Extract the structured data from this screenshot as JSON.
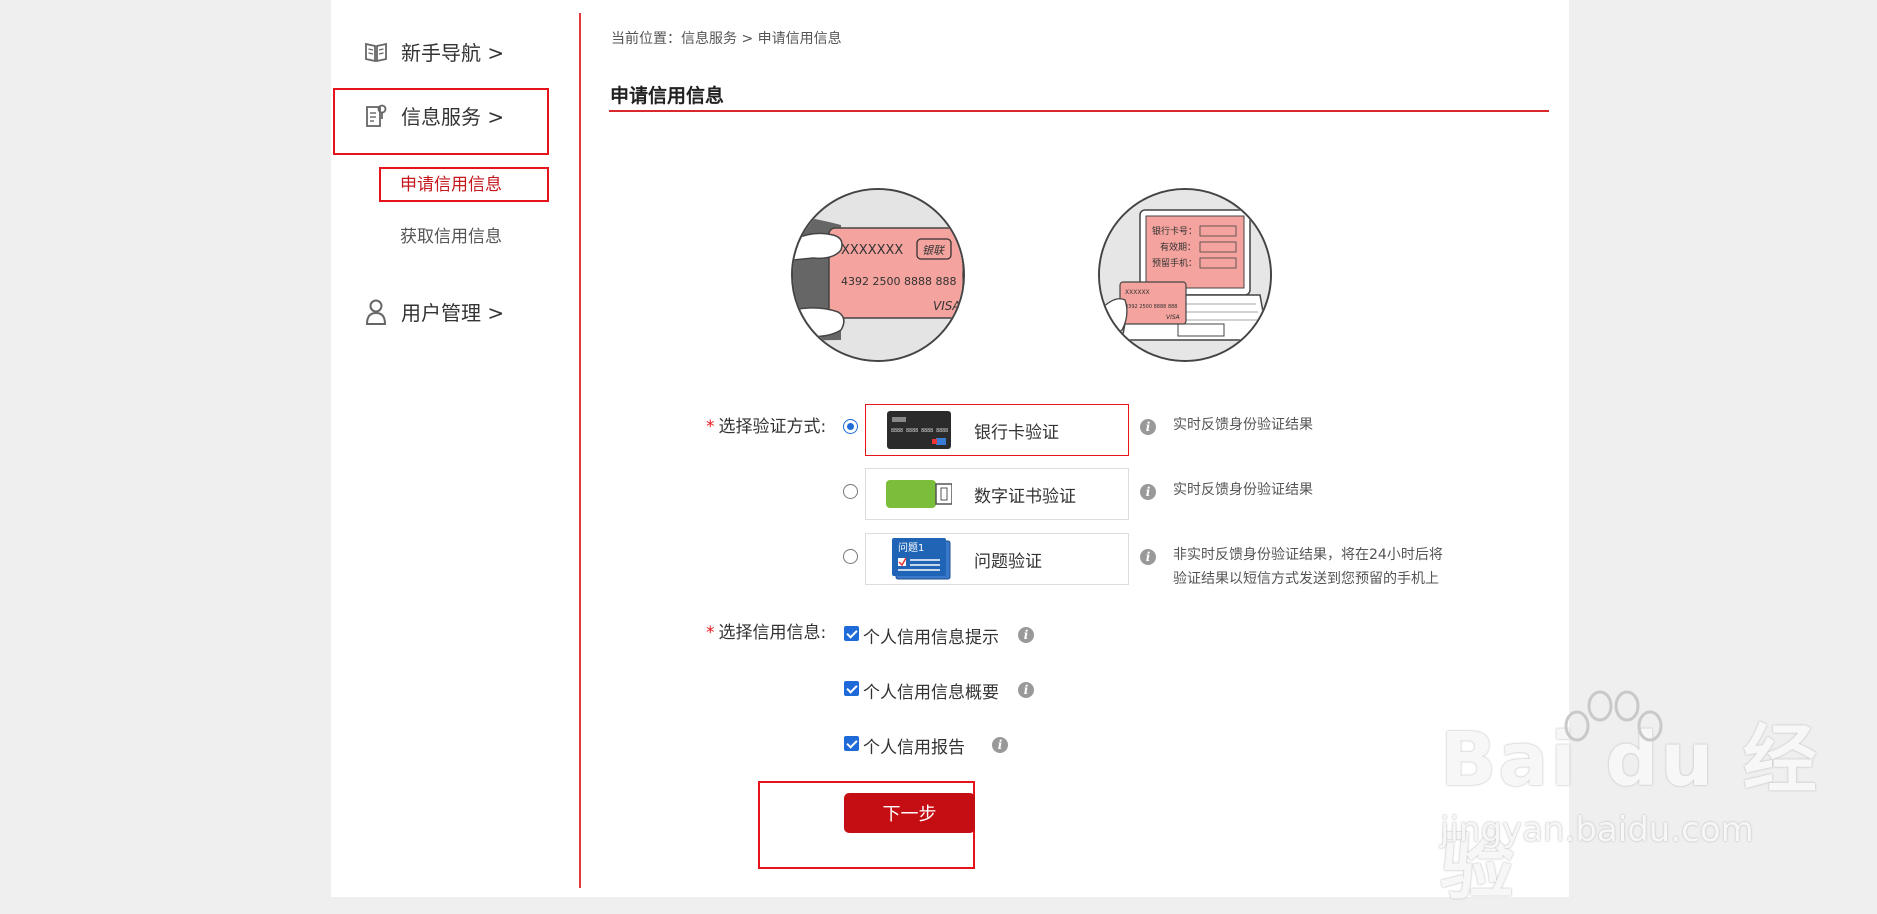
{
  "sidebar": {
    "items": [
      {
        "label": "新手导航 >",
        "icon": "book-icon"
      },
      {
        "label": "信息服务 >",
        "icon": "document-icon"
      },
      {
        "label": "用户管理 >",
        "icon": "user-icon"
      }
    ],
    "sub_items": [
      {
        "label": "申请信用信息",
        "active": true
      },
      {
        "label": "获取信用信息",
        "active": false
      }
    ]
  },
  "breadcrumb": "当前位置：信息服务 > 申请信用信息",
  "page_title": "申请信用信息",
  "illustrations": {
    "card": {
      "name": "XXXXXXX",
      "brand": "银联",
      "number": "4392 2500 8888 888",
      "scheme": "VISA"
    },
    "laptop": {
      "fields": [
        "银行卡号：",
        "有效期：",
        "预留手机："
      ],
      "card_name": "XXXXXX",
      "card_number": "4392 2500 8888 888",
      "card_scheme": "VISA"
    }
  },
  "verify": {
    "label": "选择验证方式:",
    "options": [
      {
        "label": "银行卡验证",
        "desc": "实时反馈身份验证结果",
        "selected": true,
        "icon": "bank-card-icon"
      },
      {
        "label": "数字证书验证",
        "desc": "实时反馈身份验证结果",
        "selected": false,
        "icon": "usb-key-icon"
      },
      {
        "label": "问题验证",
        "desc_lines": [
          "非实时反馈身份验证结果，将在24小时后将",
          "验证结果以短信方式发送到您预留的手机上"
        ],
        "selected": false,
        "icon": "question-card-icon",
        "icon_text": "问题1"
      }
    ]
  },
  "credit_info": {
    "label": "选择信用信息:",
    "options": [
      {
        "label": "个人信用信息提示",
        "checked": true
      },
      {
        "label": "个人信用信息概要",
        "checked": true
      },
      {
        "label": "个人信用报告",
        "checked": true
      }
    ]
  },
  "next_button": "下一步",
  "watermark": {
    "brand": "Bai du 经验",
    "url": "jingyan.baidu.com"
  },
  "colors": {
    "accent": "#c40e13",
    "highlight": "#e5141b",
    "link_active": "#c6171c"
  }
}
